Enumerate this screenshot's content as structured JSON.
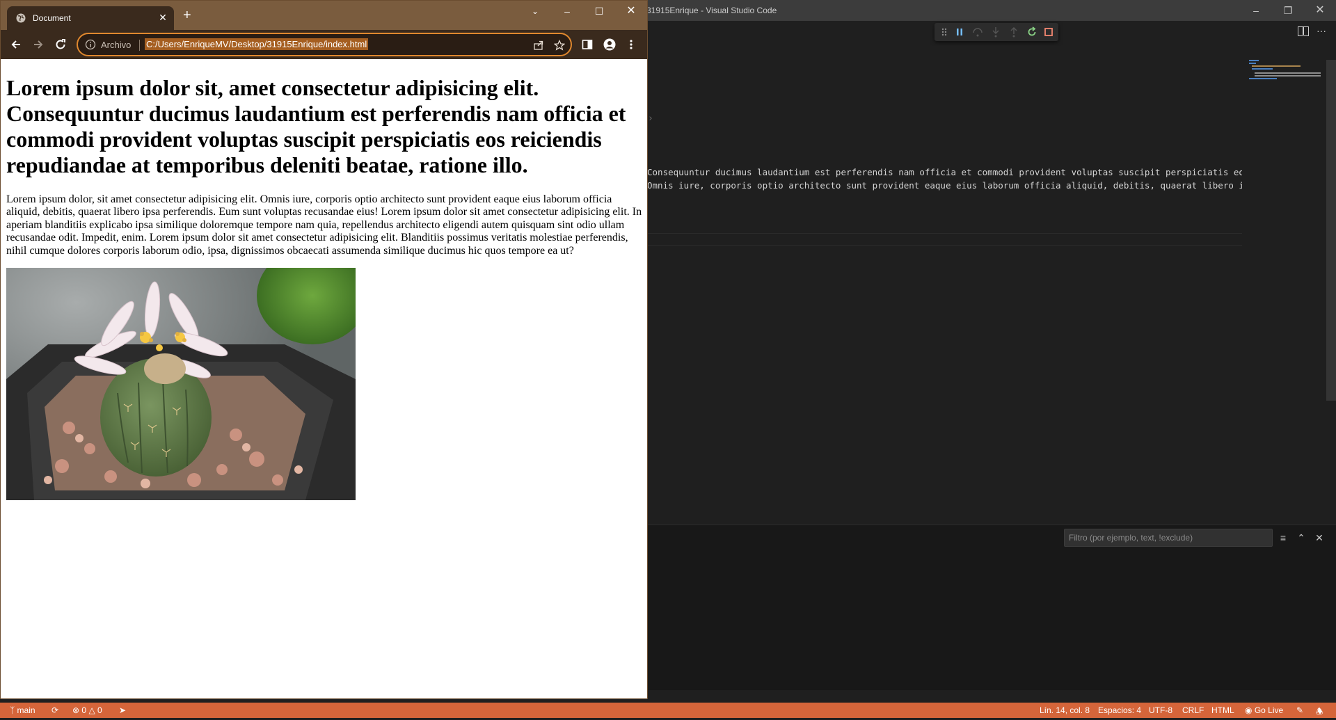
{
  "vscode": {
    "title": "31915Enrique - Visual Studio Code",
    "code_lines": [
      "Consequuntur ducimus laudantium est perferendis nam officia et commodi provident voluptas suscipit perspiciatis eos reiciendis",
      "Omnis iure, corporis optio architecto sunt provident eaque eius laborum officia aliquid, debitis, quaerat libero ipsa"
    ],
    "panel": {
      "filter_placeholder": "Filtro (por ejemplo, text, !exclude)"
    },
    "statusbar": {
      "branch": "main",
      "errors": "0",
      "warnings": "0",
      "position": "Lín. 14, col. 8",
      "spaces": "Espacios: 4",
      "encoding": "UTF-8",
      "eol": "CRLF",
      "language": "HTML",
      "go_live": "Go Live"
    },
    "colors": {
      "statusbar": "#d5653a",
      "editor_bg": "#1f1f1f"
    }
  },
  "browser": {
    "tab_title": "Document",
    "omnibox_scheme": "Archivo",
    "url": "C:/Users/EnriqueMV/Desktop/31915Enrique/index.html",
    "colors": {
      "frame": "#7a5c3e",
      "toolbar": "#3a2a1d",
      "accent": "#e0882e"
    }
  },
  "page": {
    "heading": "Lorem ipsum dolor sit, amet consectetur adipisicing elit. Consequuntur ducimus laudantium est perferendis nam officia et commodi provident voluptas suscipit perspiciatis eos reiciendis repudiandae at temporibus deleniti beatae, ratione illo.",
    "paragraph": "Lorem ipsum dolor, sit amet consectetur adipisicing elit. Omnis iure, corporis optio architecto sunt provident eaque eius laborum officia aliquid, debitis, quaerat libero ipsa perferendis. Eum sunt voluptas recusandae eius! Lorem ipsum dolor sit amet consectetur adipisicing elit. In aperiam blanditiis explicabo ipsa similique doloremque tempore nam quia, repellendus architecto eligendi autem quisquam sint odio ullam recusandae odit. Impedit, enim. Lorem ipsum dolor sit amet consectetur adipisicing elit. Blanditiis possimus veritatis molestiae perferendis, nihil cumque dolores corporis laborum odio, ipsa, dignissimos obcaecati assumenda similique ducimus hic quos tempore ea ut?",
    "image_subject": "cactus-with-flower-photo"
  }
}
